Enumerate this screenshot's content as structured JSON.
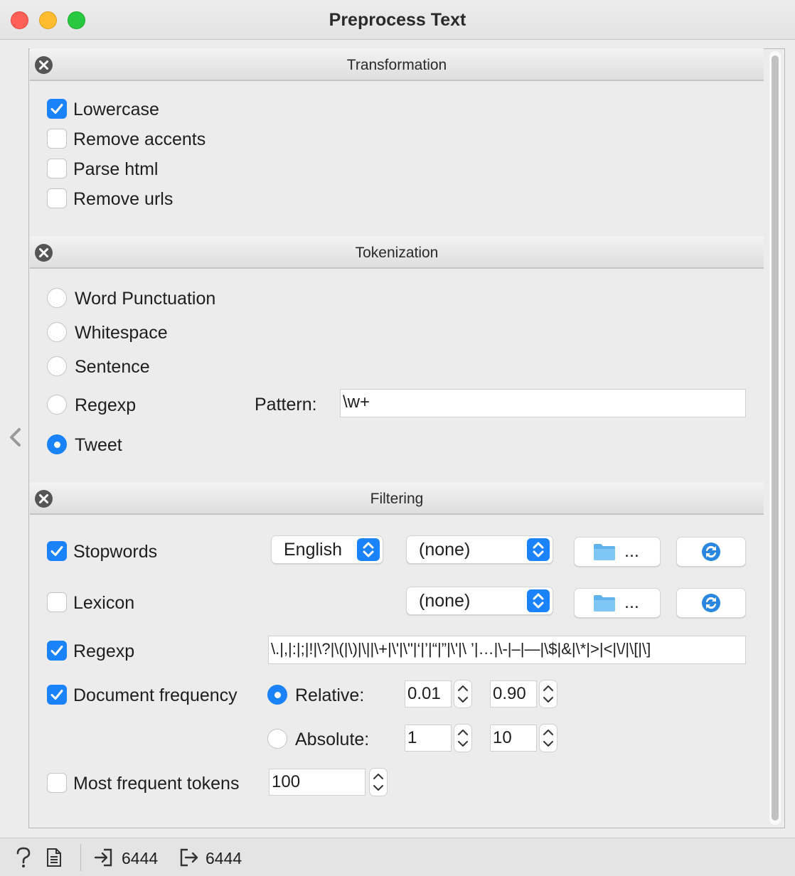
{
  "window": {
    "title": "Preprocess Text"
  },
  "transformation": {
    "header": "Transformation",
    "options": [
      {
        "label": "Lowercase",
        "checked": true
      },
      {
        "label": "Remove accents",
        "checked": false
      },
      {
        "label": "Parse html",
        "checked": false
      },
      {
        "label": "Remove urls",
        "checked": false
      }
    ]
  },
  "tokenization": {
    "header": "Tokenization",
    "options": [
      {
        "label": "Word  Punctuation",
        "selected": false
      },
      {
        "label": "Whitespace",
        "selected": false
      },
      {
        "label": "Sentence",
        "selected": false
      },
      {
        "label": "Regexp",
        "selected": false
      },
      {
        "label": "Tweet",
        "selected": true
      }
    ],
    "pattern_label": "Pattern:",
    "pattern_value": "\\w+"
  },
  "filtering": {
    "header": "Filtering",
    "stopwords": {
      "label": "Stopwords",
      "checked": true,
      "language": "English",
      "file": "(none)",
      "browse_label": "..."
    },
    "lexicon": {
      "label": "Lexicon",
      "checked": false,
      "file": "(none)",
      "browse_label": "..."
    },
    "regexp": {
      "label": "Regexp",
      "checked": true,
      "value": "\\.|,|:|;|!|\\?|\\(|\\)|\\||\\+|\\'|\\\"|‘|’|“|”|\\'|\\ ’|…|\\-|–|—|\\$|&|\\*|>|<|\\/|\\[|\\]"
    },
    "doc_freq": {
      "label": "Document frequency",
      "checked": true,
      "relative_label": "Relative:",
      "relative_selected": true,
      "relative_min": "0.01",
      "relative_max": "0.90",
      "absolute_label": "Absolute:",
      "absolute_selected": false,
      "absolute_min": "1",
      "absolute_max": "10"
    },
    "most_frequent": {
      "label": "Most frequent tokens",
      "checked": false,
      "value": "100"
    }
  },
  "status": {
    "input_count": "6444",
    "output_count": "6444"
  },
  "colors": {
    "accent": "#1a82fb",
    "close": "#fe5f57",
    "minimize": "#febc2e",
    "maximize": "#28c840"
  }
}
